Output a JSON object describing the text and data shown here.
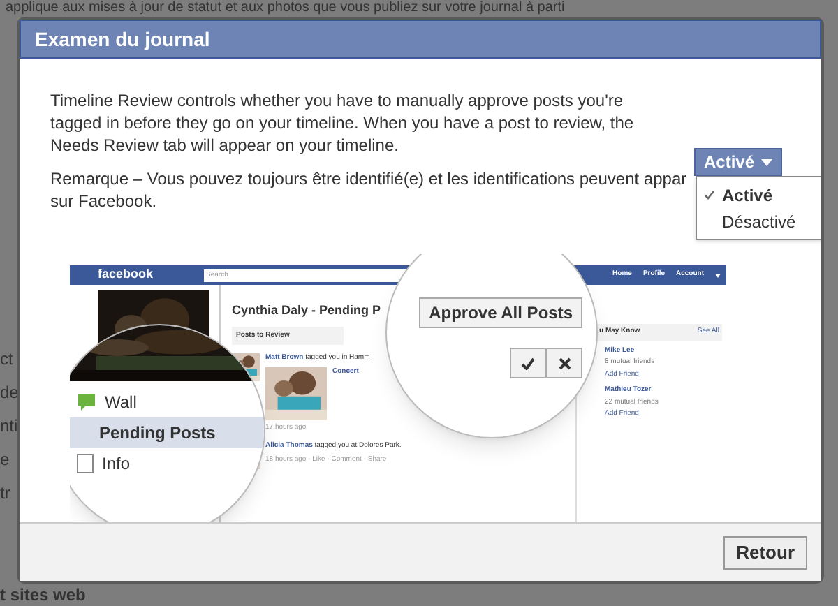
{
  "background_page": {
    "top_line": "applique aux mises à jour de statut et aux photos que vous publiez sur votre journal à parti",
    "side_fragments": [
      "ct",
      "de",
      "nti",
      "e",
      "tr"
    ],
    "bottom_line": "t sites web"
  },
  "dialog": {
    "title": "Examen du journal",
    "description": "Timeline Review controls whether you have to manually approve posts you're tagged in before they go on your timeline. When you have a post to review, the Needs Review tab will appear on your timeline.",
    "note_lines": [
      "Remarque – Vous pouvez toujours être identifié(e) et les identifications peuvent appar",
      "sur Facebook."
    ],
    "dropdown": {
      "value": "Activé",
      "options": [
        {
          "label": "Activé",
          "selected": true
        },
        {
          "label": "Désactivé",
          "selected": false
        }
      ]
    },
    "illustration": {
      "logo": "facebook",
      "search_placeholder": "Search",
      "nav": [
        "Home",
        "Profile",
        "Account"
      ],
      "page_title": "Cynthia Daly - Pending P",
      "section_heading": "Posts to Review",
      "posts": [
        {
          "author": "Matt Brown",
          "text": "tagged you in Hamm",
          "caption": "Concert",
          "time": "17 hours ago"
        },
        {
          "author": "Alicia Thomas",
          "text": "tagged you at Dolores Park.",
          "time": "18 hours ago · Like · Comment · Share"
        }
      ],
      "suggestions_heading": "u May Know",
      "see_all": "See All",
      "people": [
        {
          "name": "Mike Lee",
          "mutual": "8 mutual friends",
          "action": "Add Friend"
        },
        {
          "name": "Mathieu Tozer",
          "mutual": "22 mutual friends",
          "action": "Add Friend"
        }
      ],
      "magnified_menu": [
        {
          "label": "Wall",
          "selected": false
        },
        {
          "label": "Pending Posts",
          "selected": true
        },
        {
          "label": "Info",
          "selected": false
        }
      ],
      "approve_button": "Approve All Posts"
    },
    "buttons": [
      {
        "label": "Retour"
      }
    ]
  }
}
